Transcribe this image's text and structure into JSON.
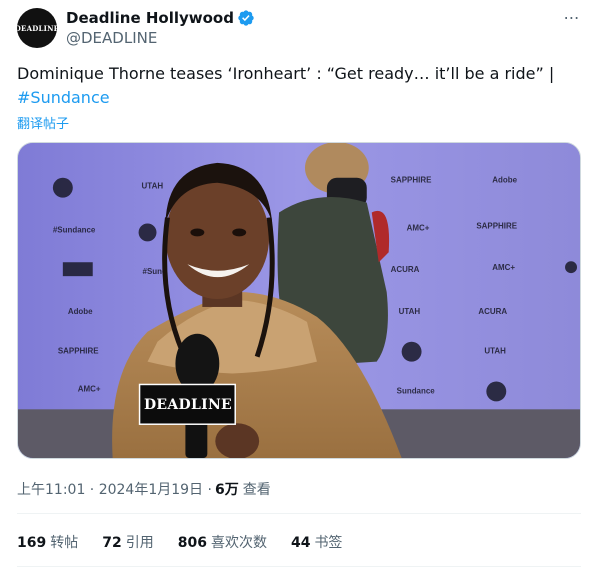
{
  "author": {
    "display_name": "Deadline Hollywood",
    "handle": "@DEADLINE",
    "avatar_text": "DEADLINE",
    "verified_icon": "verified-badge-icon"
  },
  "more_icon": "⋯",
  "tweet": {
    "text": "Dominique Thorne teases ‘Ironheart’ : “Get ready… it’ll be a ride” | ",
    "hashtag": "#Sundance",
    "translate_label": "翻译帖子"
  },
  "media": {
    "mic_flag_text": "DEADLINE",
    "backdrop_logos": [
      "Adobe",
      "#Sundance",
      "SAPPHIRE",
      "ACURA",
      "AMC+",
      "UTAH"
    ]
  },
  "meta": {
    "timestamp": "上午11:01 · 2024年1月19日 · ",
    "views_count": "6万",
    "views_label": "查看"
  },
  "stats": {
    "reposts_count": "169",
    "reposts_label": "转帖",
    "quotes_count": "72",
    "quotes_label": "引用",
    "likes_count": "806",
    "likes_label": "喜欢次数",
    "bookmarks_count": "44",
    "bookmarks_label": "书签"
  },
  "colors": {
    "accent": "#1d9bf0",
    "text_primary": "#0f1419",
    "text_secondary": "#536471"
  }
}
